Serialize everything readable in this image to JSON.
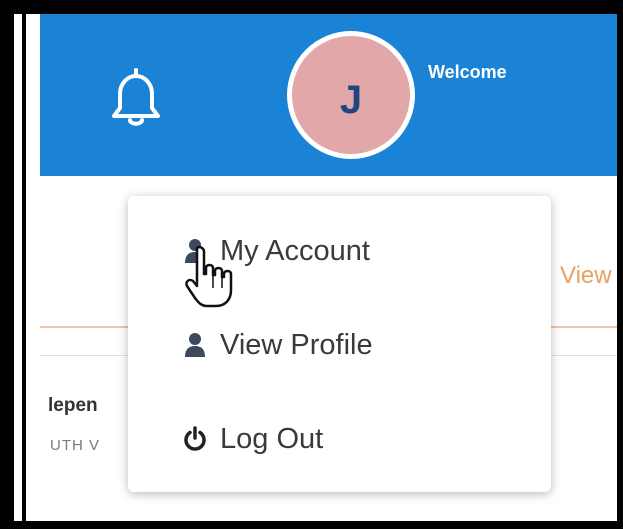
{
  "header": {
    "welcome_text": "Welcome",
    "avatar_initial": "J",
    "bar_color": "#1a83d6",
    "avatar_color": "#e1a7a9",
    "icons": [
      "bell-icon"
    ]
  },
  "background": {
    "link_fragment": "View",
    "text_fragment_1": "lepen",
    "text_fragment_2": "UTH V"
  },
  "user_menu": {
    "items": [
      {
        "label": "My Account",
        "icon": "user-icon"
      },
      {
        "label": "View Profile",
        "icon": "user-icon"
      },
      {
        "label": "Log Out",
        "icon": "power-icon"
      }
    ]
  },
  "cursor": {
    "icon": "hand-pointer-icon"
  }
}
